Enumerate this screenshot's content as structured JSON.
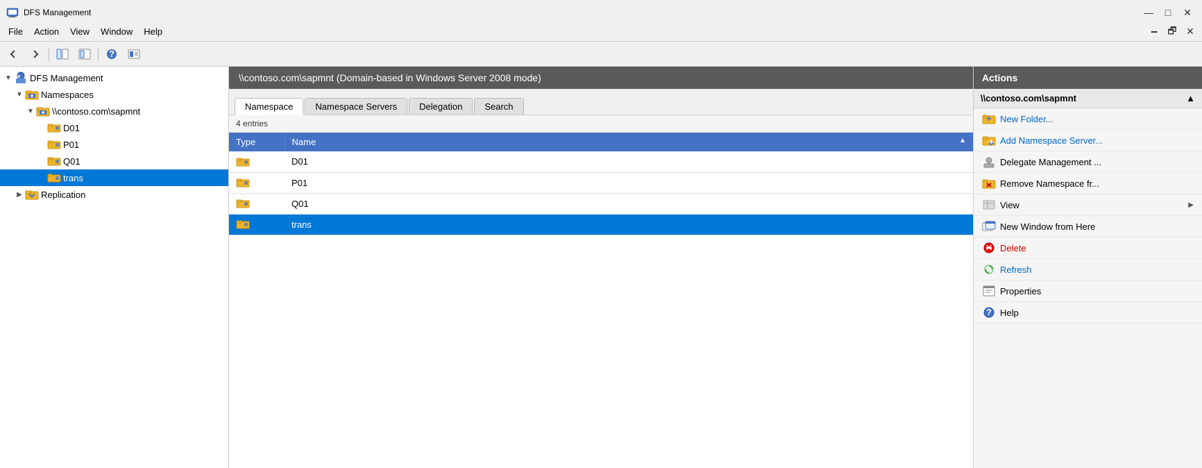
{
  "window": {
    "title": "DFS Management",
    "icon": "🖥️"
  },
  "titlebar_controls": {
    "minimize": "—",
    "maximize": "□",
    "close": "✕"
  },
  "inner_controls": {
    "restore": "🗕",
    "maximize2": "🗗",
    "close2": "✕"
  },
  "menu": {
    "items": [
      "File",
      "Action",
      "View",
      "Window",
      "Help"
    ]
  },
  "toolbar": {
    "buttons": [
      "◀",
      "▶",
      "📄",
      "🔙",
      "❓",
      "🖥️"
    ]
  },
  "tree": {
    "items": [
      {
        "label": "DFS Management",
        "level": 0,
        "expand": "▼",
        "icon": "dfs"
      },
      {
        "label": "Namespaces",
        "level": 1,
        "expand": "▼",
        "icon": "namespaces"
      },
      {
        "label": "\\\\contoso.com\\sapmnt",
        "level": 2,
        "expand": "▼",
        "icon": "namespace"
      },
      {
        "label": "D01",
        "level": 3,
        "expand": "",
        "icon": "folder"
      },
      {
        "label": "P01",
        "level": 3,
        "expand": "",
        "icon": "folder"
      },
      {
        "label": "Q01",
        "level": 3,
        "expand": "",
        "icon": "folder"
      },
      {
        "label": "trans",
        "level": 3,
        "expand": "",
        "icon": "folder",
        "selected": true
      },
      {
        "label": "Replication",
        "level": 1,
        "expand": "▶",
        "icon": "replication"
      }
    ]
  },
  "content": {
    "header": "\\\\contoso.com\\sapmnt    (Domain-based in Windows Server 2008 mode)",
    "tabs": [
      {
        "label": "Namespace",
        "active": true
      },
      {
        "label": "Namespace Servers",
        "active": false
      },
      {
        "label": "Delegation",
        "active": false
      },
      {
        "label": "Search",
        "active": false
      }
    ],
    "entry_count": "4 entries",
    "table": {
      "columns": [
        {
          "label": "Type",
          "class": "th-type"
        },
        {
          "label": "Name",
          "sort": "▲"
        }
      ],
      "rows": [
        {
          "icon": "folder",
          "name": "D01",
          "selected": false
        },
        {
          "icon": "folder",
          "name": "P01",
          "selected": false
        },
        {
          "icon": "folder",
          "name": "Q01",
          "selected": false
        },
        {
          "icon": "folder",
          "name": "trans",
          "selected": true
        }
      ]
    }
  },
  "actions": {
    "panel_title": "Actions",
    "section_title": "\\\\contoso.com\\sapmnt",
    "items": [
      {
        "label": "New Folder...",
        "icon": "new-folder",
        "color": true
      },
      {
        "label": "Add Namespace Server...",
        "icon": "add-ns",
        "color": true
      },
      {
        "label": "Delegate Management ...",
        "icon": "delegate",
        "color": false
      },
      {
        "label": "Remove Namespace fr...",
        "icon": "remove-ns",
        "color": false
      },
      {
        "label": "View",
        "icon": "view",
        "color": false,
        "submenu": "▶"
      },
      {
        "label": "New Window from Here",
        "icon": "new-window",
        "color": false
      },
      {
        "label": "Delete",
        "icon": "delete",
        "color": true,
        "red": true
      },
      {
        "label": "Refresh",
        "icon": "refresh",
        "color": true
      },
      {
        "label": "Properties",
        "icon": "properties",
        "color": false
      },
      {
        "label": "Help",
        "icon": "help",
        "color": false
      }
    ]
  }
}
